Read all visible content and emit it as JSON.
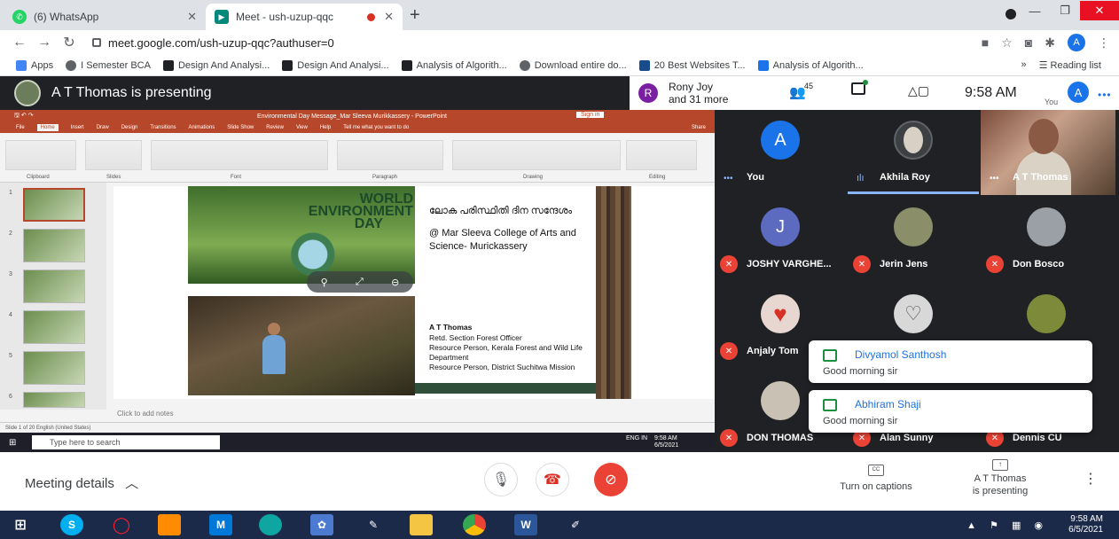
{
  "browser": {
    "tabs": [
      {
        "label": "(6) WhatsApp",
        "active": false
      },
      {
        "label": "Meet - ush-uzup-qqc",
        "active": true
      }
    ],
    "url": "meet.google.com/ush-uzup-qqc?authuser=0",
    "profile_initial": "A",
    "bookmarks": [
      "Apps",
      "I Semester BCA",
      "Design And Analysi...",
      "Design And Analysi...",
      "Analysis of Algorith...",
      "Download entire do...",
      "20 Best Websites T...",
      "Analysis of Algorith..."
    ],
    "bookmarks_more": "»",
    "reading_list": "Reading list"
  },
  "meet": {
    "presenting_title": "A T Thomas is presenting",
    "host_initial": "R",
    "host_line1": "Rony Joy",
    "host_line2": "and 31 more",
    "people_count": "45",
    "time": "9:58 AM",
    "self_initial": "A",
    "self_label": "You",
    "participants": [
      {
        "name": "You",
        "initial": "A",
        "color": "#1a73e8",
        "muted": false
      },
      {
        "name": "Akhila Roy",
        "initial": "",
        "color": "#3c4043",
        "muted": false
      },
      {
        "name": "A T Thomas",
        "initial": "",
        "color": "#7a4b3a",
        "muted": false
      },
      {
        "name": "JOSHY VARGHE...",
        "initial": "J",
        "color": "#5c6bc0",
        "muted": true
      },
      {
        "name": "Jerin Jens",
        "initial": "",
        "color": "#8a8f6a",
        "muted": true
      },
      {
        "name": "Don Bosco",
        "initial": "",
        "color": "#9aa0a6",
        "muted": true
      },
      {
        "name": "Anjaly Tom",
        "initial": "",
        "color": "#e8d7d0",
        "muted": true
      },
      {
        "name": "",
        "initial": "",
        "color": "#d8d8d8",
        "muted": false
      },
      {
        "name": "",
        "initial": "",
        "color": "#7d8a3a",
        "muted": false
      },
      {
        "name": "DON THOMAS",
        "initial": "",
        "color": "#c9c2b4",
        "muted": true
      },
      {
        "name": "Alan Sunny",
        "initial": "",
        "color": "#3c4043",
        "muted": true
      },
      {
        "name": "Dennis CU",
        "initial": "",
        "color": "#3c4043",
        "muted": true
      }
    ],
    "chat_notifications": [
      {
        "sender": "Divyamol Santhosh",
        "message": "Good morning sir"
      },
      {
        "sender": "Abhiram Shaji",
        "message": "Good morning sir"
      }
    ],
    "meeting_details": "Meeting details",
    "captions_label": "Turn on captions",
    "presenter_line1": "A T Thomas",
    "presenter_line2": "is presenting"
  },
  "ppt": {
    "doc_title": "Environmental Day Message_Mar Sleeva Murikkassery - PowerPoint",
    "sign_in": "Sign in",
    "tabs": [
      "File",
      "Home",
      "Insert",
      "Draw",
      "Design",
      "Transitions",
      "Animations",
      "Slide Show",
      "Review",
      "View",
      "Help",
      "Tell me what you want to do"
    ],
    "share_label": "Share",
    "ribbon_groups": [
      "Clipboard",
      "Slides",
      "Font",
      "Paragraph",
      "Drawing",
      "Editing"
    ],
    "thumb_numbers": [
      "1",
      "2",
      "3",
      "4",
      "5",
      "6"
    ],
    "notes_placeholder": "Click to add notes",
    "status": "Slide 1 of 20    English (United States)",
    "slide": {
      "banner_line1": "WORLD",
      "banner_line2": "ENVIRONMENT",
      "banner_line3": "DAY",
      "malayalam": "ലോക പരിസ്ഥിതി ദിന സന്ദേശം",
      "college": "@ Mar Sleeva College of Arts and Science- Murickassery",
      "speaker": "A T Thomas",
      "cred1": "Retd. Section Forest Officer",
      "cred2": "Resource Person, Kerala Forest and Wild Life Department",
      "cred3": "Resource Person, District Suchitwa Mission"
    },
    "search_placeholder": "Type here to search",
    "tray_lang": "ENG IN",
    "tray_time": "9:58 AM",
    "tray_date": "6/5/2021"
  },
  "taskbar": {
    "time": "9:58 AM",
    "date": "6/5/2021"
  }
}
